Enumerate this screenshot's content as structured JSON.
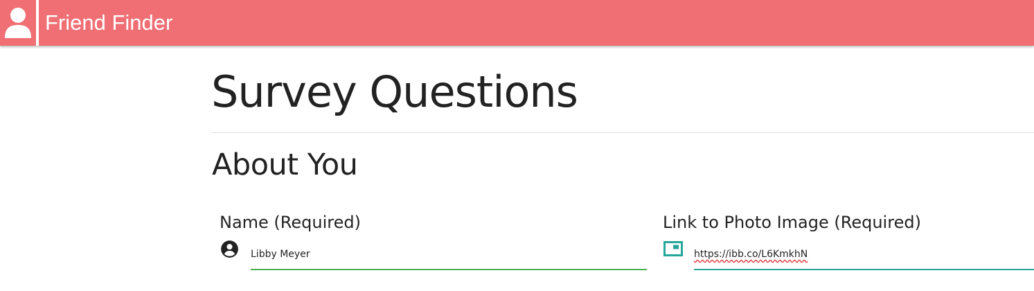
{
  "navbar": {
    "brand_title": "Friend Finder",
    "color": "#ef6f74",
    "logo_icon": "user-icon"
  },
  "page": {
    "title": "Survey Questions",
    "section_title": "About You"
  },
  "form": {
    "name": {
      "label": "Name (Required)",
      "value": "Libby Meyer",
      "icon": "account-circle-icon",
      "underline_color": "#4caf50"
    },
    "photo": {
      "label": "Link to Photo Image (Required)",
      "value": "https://ibb.co/L6KmkhN",
      "icon": "image-frame-icon",
      "icon_color": "#26a69a",
      "underline_color": "#26a69a"
    }
  }
}
